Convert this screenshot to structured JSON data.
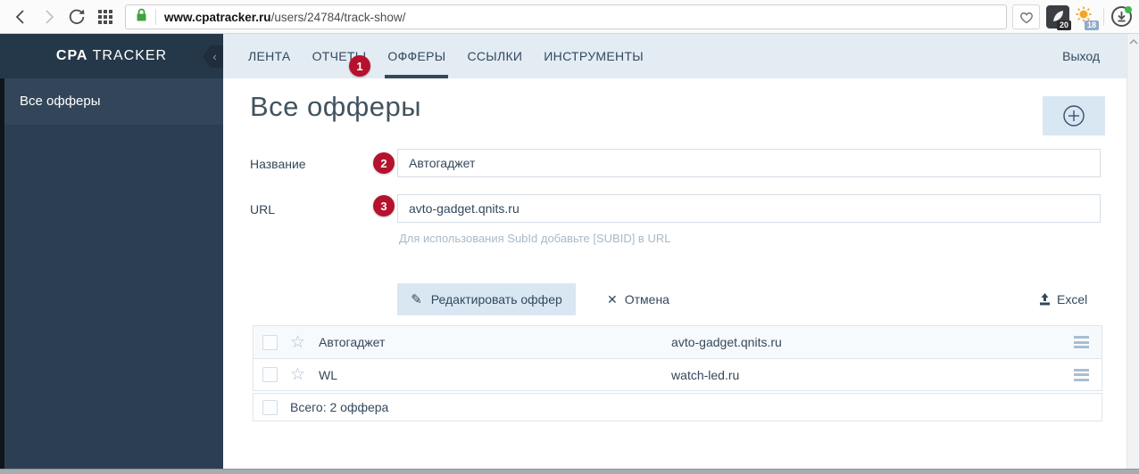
{
  "browser": {
    "url_domain": "www.cpatracker.ru",
    "url_path": "/users/24784/track-show/",
    "ext_screenshot_badge": "20",
    "ext_weather_badge": "18"
  },
  "sidebar": {
    "logo_primary": "CPA",
    "logo_secondary": " TRACKER",
    "item_all_offers": "Все офферы"
  },
  "nav": {
    "feed": "ЛЕНТА",
    "reports": "ОТЧЕТЫ",
    "offers": "ОФФЕРЫ",
    "links": "ССЫЛКИ",
    "tools": "ИНСТРУМЕНТЫ",
    "logout": "Выход"
  },
  "page": {
    "title": "Все офферы"
  },
  "annotations": {
    "step1": "1",
    "step2": "2",
    "step3": "3"
  },
  "form": {
    "name_label": "Название",
    "name_value": "Автогаджет",
    "url_label": "URL",
    "url_value": "avto-gadget.qnits.ru",
    "subid_hint": "Для использования SubId добавьте [SUBID] в URL",
    "edit_button": "Редактировать оффер",
    "cancel_button": "Отмена",
    "excel_button": "Excel"
  },
  "table": {
    "rows": [
      {
        "name": "Автогаджет",
        "url": "avto-gadget.qnits.ru"
      },
      {
        "name": "WL",
        "url": "watch-led.ru"
      }
    ],
    "total_label": "Всего: 2 оффера"
  },
  "colors": {
    "sidebar_bg": "#2c3f52",
    "sidebar_header_bg": "#253849",
    "sidebar_active_bg": "#334659",
    "nav_bg": "#e3ecf3",
    "accent_navy": "#33485c",
    "badge_red": "#b5122d",
    "button_blue_bg": "#d9e7f3",
    "muted_blue": "#a9bfd2",
    "lock_green": "#3fa33f"
  }
}
